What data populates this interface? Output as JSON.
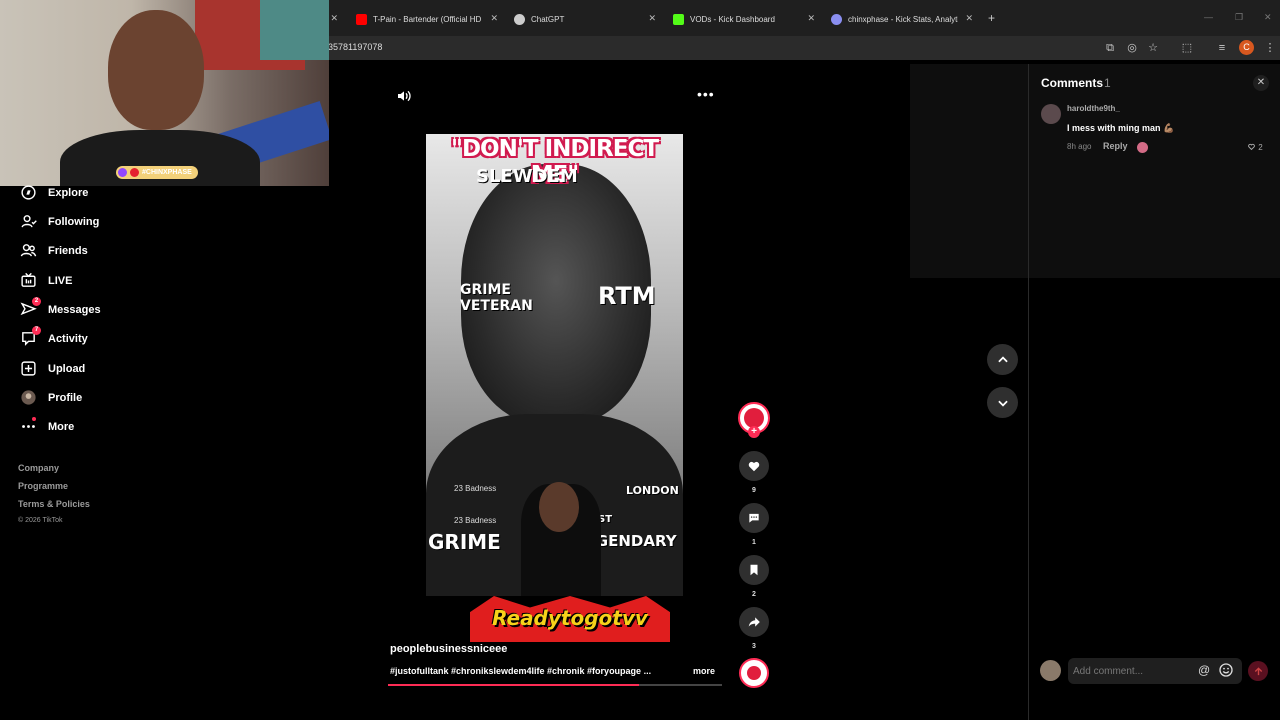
{
  "browser": {
    "tabs": [
      {
        "title": "T-Pain - Bartender (Official HD",
        "favicon_color": "#ff0000"
      },
      {
        "title": "ChatGPT",
        "favicon_color": "#cccccc"
      },
      {
        "title": "VODs - Kick Dashboard",
        "favicon_color": "#53fc18"
      },
      {
        "title": "chinxphase - Kick Stats, Analyti",
        "favicon_color": "#8a8ef0"
      }
    ],
    "url": "35781197078",
    "profile_initial": "C"
  },
  "webcam": {
    "badge_text": "#CHINXPHASE"
  },
  "sidebar": {
    "items": [
      {
        "label": "Explore",
        "icon": "compass-icon"
      },
      {
        "label": "Following",
        "icon": "following-icon"
      },
      {
        "label": "Friends",
        "icon": "friends-icon"
      },
      {
        "label": "LIVE",
        "icon": "live-icon"
      },
      {
        "label": "Messages",
        "icon": "messages-icon",
        "badge": "2"
      },
      {
        "label": "Activity",
        "icon": "activity-icon",
        "badge": "7"
      },
      {
        "label": "Upload",
        "icon": "upload-icon"
      },
      {
        "label": "Profile",
        "icon": "profile-avatar"
      },
      {
        "label": "More",
        "icon": "more-icon"
      }
    ],
    "footer": {
      "company": "Company",
      "programme": "Programme",
      "terms": "Terms & Policies",
      "copyright": "© 2026 TikTok"
    }
  },
  "video": {
    "overlay_title": "\"DON'T INDIRECT ME\"",
    "poster_words": {
      "top": "SLEWDEM",
      "left": "GRIME VETERAN",
      "right": "RTM",
      "bottom_left": "GRIME",
      "bottom_right": "LEGENDARY",
      "co_host": "CO-HOST",
      "london": "LONDON"
    },
    "chat_lines": [
      "23 Badness",
      "23 Badness"
    ],
    "sticker_text": "Readytogotvv",
    "author": "peoplebusinessniceee",
    "caption": "#justofulltank #chronikslewdem4life #chronik #foryoupage ...",
    "more_label": "more",
    "progress": 0.75
  },
  "actions": {
    "likes": "9",
    "comments": "1",
    "saves": "2",
    "shares": "3"
  },
  "comments": {
    "title": "Comments",
    "count": "1",
    "items": [
      {
        "user": "haroldthe9th_",
        "text": "I mess with ming man 💪🏽",
        "time": "8h ago",
        "reply": "Reply",
        "likes": "2"
      }
    ],
    "input_placeholder": "Add comment..."
  },
  "colors": {
    "accent": "#fe2c55"
  }
}
